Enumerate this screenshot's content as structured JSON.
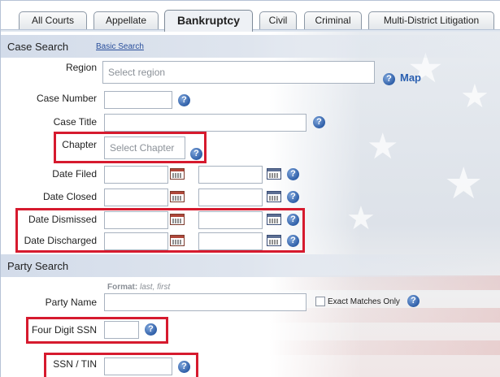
{
  "tabs": [
    {
      "label": "All Courts",
      "active": false
    },
    {
      "label": "Appellate",
      "active": false
    },
    {
      "label": "Bankruptcy",
      "active": true
    },
    {
      "label": "Civil",
      "active": false
    },
    {
      "label": "Criminal",
      "active": false
    },
    {
      "label": "Multi-District Litigation",
      "active": false
    }
  ],
  "case_search": {
    "title": "Case Search",
    "basic_link": "Basic Search",
    "region": {
      "label": "Region",
      "placeholder": "Select region",
      "map_link": "Map"
    },
    "case_number": {
      "label": "Case Number"
    },
    "case_title": {
      "label": "Case Title"
    },
    "chapter": {
      "label": "Chapter",
      "placeholder": "Select Chapter"
    },
    "date_filed": {
      "label": "Date Filed"
    },
    "date_closed": {
      "label": "Date Closed"
    },
    "date_dismissed": {
      "label": "Date Dismissed"
    },
    "date_discharged": {
      "label": "Date Discharged"
    }
  },
  "party_search": {
    "title": "Party Search",
    "party_name": {
      "label": "Party Name",
      "format_label": "Format:",
      "format_value": "last, first"
    },
    "exact_matches": {
      "label": "Exact Matches Only",
      "checked": false
    },
    "four_digit_ssn": {
      "label": "Four Digit SSN"
    },
    "ssn_tin": {
      "label": "SSN / TIN"
    }
  },
  "icons": {
    "help": "help-icon",
    "calendar": "calendar-icon",
    "checkbox": "checkbox-icon"
  },
  "colors": {
    "highlight": "#d61a2e",
    "link": "#2a4f9c",
    "help_icon": "#2f5fa8",
    "section_bg": "#d3dcea"
  }
}
